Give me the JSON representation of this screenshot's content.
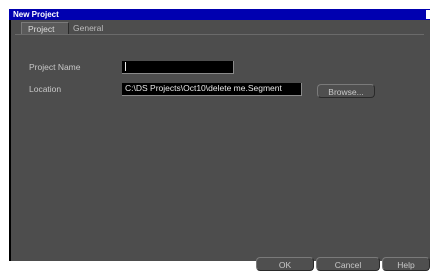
{
  "window": {
    "title": "New Project"
  },
  "tabs": [
    {
      "label": "Project",
      "active": true
    },
    {
      "label": "General",
      "active": false
    }
  ],
  "form": {
    "project_name": {
      "label": "Project Name",
      "value": ""
    },
    "location": {
      "label": "Location",
      "value": "C:\\DS Projects\\Oct10\\delete me.Segment"
    },
    "browse_label": "Browse..."
  },
  "footer": {
    "ok_label": "OK",
    "cancel_label": "Cancel",
    "help_label": "Help"
  },
  "colors": {
    "titlebar": "#0000b0",
    "dialog_bg": "#4d4d4d",
    "field_bg": "#000000"
  }
}
